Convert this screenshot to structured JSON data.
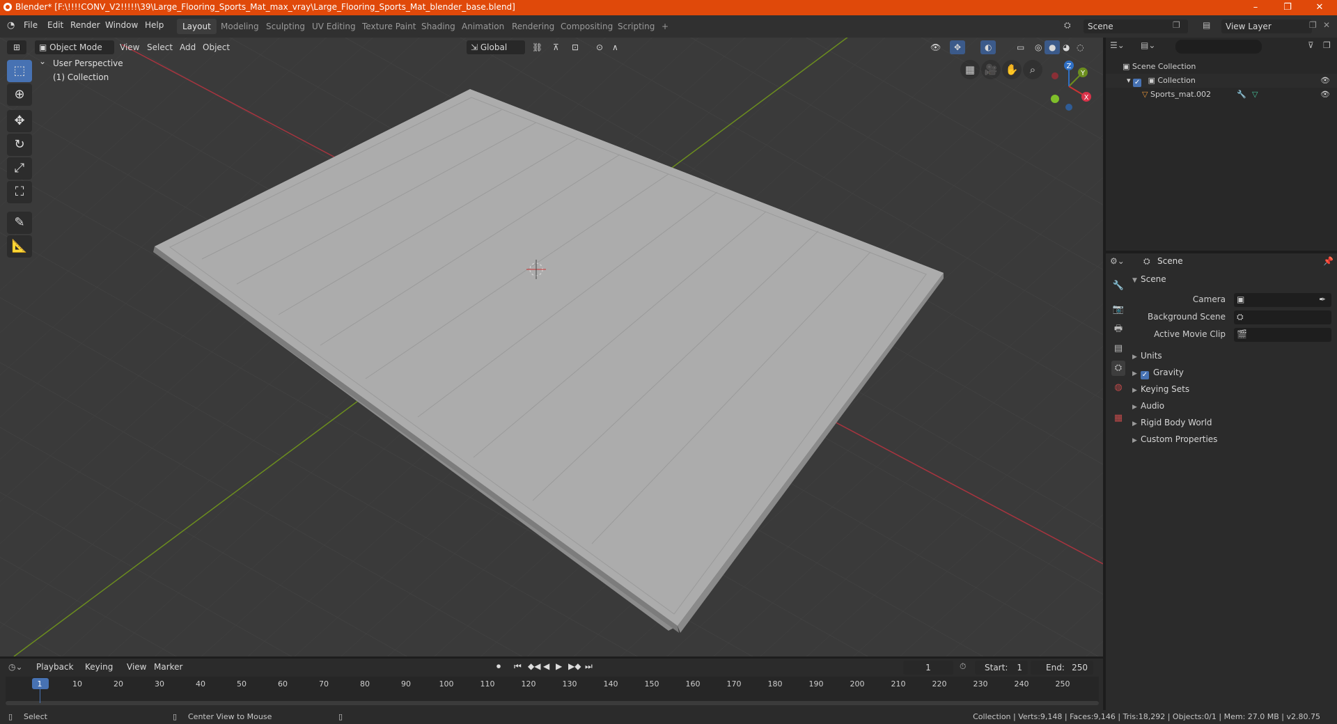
{
  "window": {
    "title": "Blender* [F:\\!!!!CONV_V2!!!!!\\39\\Large_Flooring_Sports_Mat_max_vray\\Large_Flooring_Sports_Mat_blender_base.blend]",
    "minimize": "–",
    "maximize": "❐",
    "close": "✕"
  },
  "menu": [
    "File",
    "Edit",
    "Render",
    "Window",
    "Help"
  ],
  "workspaces": [
    "Layout",
    "Modeling",
    "Sculpting",
    "UV Editing",
    "Texture Paint",
    "Shading",
    "Animation",
    "Rendering",
    "Compositing",
    "Scripting"
  ],
  "workspace_add": "+",
  "scene_field": "Scene",
  "view_layer_field": "View Layer",
  "viewport_header": {
    "mode": "Object Mode",
    "menus": [
      "View",
      "Select",
      "Add",
      "Object"
    ],
    "orientation": "Global"
  },
  "viewport": {
    "perspective_label": "User Perspective",
    "collection_label": "(1) Collection",
    "gizmo": {
      "x": "X",
      "y": "Y",
      "z": "Z"
    },
    "colors": {
      "floor": "#a9a9a9",
      "floor_side": "#8e8e8e",
      "x_axis": "#a8343f",
      "y_axis": "#6c8e1e",
      "grid": "#454545"
    }
  },
  "toolbar_icons": [
    "select-box-icon",
    "cursor-icon",
    "move-icon",
    "rotate-icon",
    "scale-icon",
    "transform-icon",
    "annotate-icon",
    "measure-icon"
  ],
  "outliner": {
    "search_placeholder": "",
    "scene_collection": "Scene Collection",
    "collection": "Collection",
    "object": "Sports_mat.002"
  },
  "properties": {
    "header": "Scene",
    "section": "Scene",
    "camera_label": "Camera",
    "background_scene_label": "Background Scene",
    "active_movie_clip_label": "Active Movie Clip",
    "panels": [
      "Units",
      "Gravity",
      "Keying Sets",
      "Audio",
      "Rigid Body World",
      "Custom Properties"
    ]
  },
  "timeline": {
    "menus": [
      "Playback",
      "Keying",
      "View",
      "Marker"
    ],
    "current_frame": "1",
    "start_label": "Start:",
    "start": "1",
    "end_label": "End:",
    "end": "250",
    "ruler": [
      "1",
      "10",
      "20",
      "30",
      "40",
      "50",
      "60",
      "70",
      "80",
      "90",
      "100",
      "110",
      "120",
      "130",
      "140",
      "150",
      "160",
      "170",
      "180",
      "190",
      "200",
      "210",
      "220",
      "230",
      "240",
      "250"
    ]
  },
  "statusbar": {
    "select": "Select",
    "center_view": "Center View to Mouse",
    "stats": "Collection | Verts:9,148 | Faces:9,146 | Tris:18,292 | Objects:0/1 | Mem: 27.0 MB | v2.80.75"
  }
}
